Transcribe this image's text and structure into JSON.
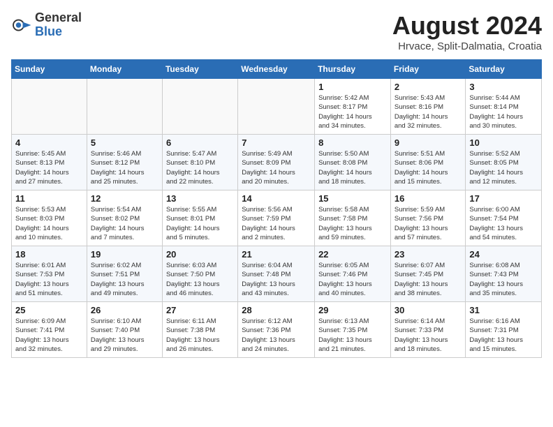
{
  "header": {
    "logo_general": "General",
    "logo_blue": "Blue",
    "month_year": "August 2024",
    "location": "Hrvace, Split-Dalmatia, Croatia"
  },
  "weekdays": [
    "Sunday",
    "Monday",
    "Tuesday",
    "Wednesday",
    "Thursday",
    "Friday",
    "Saturday"
  ],
  "weeks": [
    [
      {
        "day": "",
        "info": ""
      },
      {
        "day": "",
        "info": ""
      },
      {
        "day": "",
        "info": ""
      },
      {
        "day": "",
        "info": ""
      },
      {
        "day": "1",
        "info": "Sunrise: 5:42 AM\nSunset: 8:17 PM\nDaylight: 14 hours\nand 34 minutes."
      },
      {
        "day": "2",
        "info": "Sunrise: 5:43 AM\nSunset: 8:16 PM\nDaylight: 14 hours\nand 32 minutes."
      },
      {
        "day": "3",
        "info": "Sunrise: 5:44 AM\nSunset: 8:14 PM\nDaylight: 14 hours\nand 30 minutes."
      }
    ],
    [
      {
        "day": "4",
        "info": "Sunrise: 5:45 AM\nSunset: 8:13 PM\nDaylight: 14 hours\nand 27 minutes."
      },
      {
        "day": "5",
        "info": "Sunrise: 5:46 AM\nSunset: 8:12 PM\nDaylight: 14 hours\nand 25 minutes."
      },
      {
        "day": "6",
        "info": "Sunrise: 5:47 AM\nSunset: 8:10 PM\nDaylight: 14 hours\nand 22 minutes."
      },
      {
        "day": "7",
        "info": "Sunrise: 5:49 AM\nSunset: 8:09 PM\nDaylight: 14 hours\nand 20 minutes."
      },
      {
        "day": "8",
        "info": "Sunrise: 5:50 AM\nSunset: 8:08 PM\nDaylight: 14 hours\nand 18 minutes."
      },
      {
        "day": "9",
        "info": "Sunrise: 5:51 AM\nSunset: 8:06 PM\nDaylight: 14 hours\nand 15 minutes."
      },
      {
        "day": "10",
        "info": "Sunrise: 5:52 AM\nSunset: 8:05 PM\nDaylight: 14 hours\nand 12 minutes."
      }
    ],
    [
      {
        "day": "11",
        "info": "Sunrise: 5:53 AM\nSunset: 8:03 PM\nDaylight: 14 hours\nand 10 minutes."
      },
      {
        "day": "12",
        "info": "Sunrise: 5:54 AM\nSunset: 8:02 PM\nDaylight: 14 hours\nand 7 minutes."
      },
      {
        "day": "13",
        "info": "Sunrise: 5:55 AM\nSunset: 8:01 PM\nDaylight: 14 hours\nand 5 minutes."
      },
      {
        "day": "14",
        "info": "Sunrise: 5:56 AM\nSunset: 7:59 PM\nDaylight: 14 hours\nand 2 minutes."
      },
      {
        "day": "15",
        "info": "Sunrise: 5:58 AM\nSunset: 7:58 PM\nDaylight: 13 hours\nand 59 minutes."
      },
      {
        "day": "16",
        "info": "Sunrise: 5:59 AM\nSunset: 7:56 PM\nDaylight: 13 hours\nand 57 minutes."
      },
      {
        "day": "17",
        "info": "Sunrise: 6:00 AM\nSunset: 7:54 PM\nDaylight: 13 hours\nand 54 minutes."
      }
    ],
    [
      {
        "day": "18",
        "info": "Sunrise: 6:01 AM\nSunset: 7:53 PM\nDaylight: 13 hours\nand 51 minutes."
      },
      {
        "day": "19",
        "info": "Sunrise: 6:02 AM\nSunset: 7:51 PM\nDaylight: 13 hours\nand 49 minutes."
      },
      {
        "day": "20",
        "info": "Sunrise: 6:03 AM\nSunset: 7:50 PM\nDaylight: 13 hours\nand 46 minutes."
      },
      {
        "day": "21",
        "info": "Sunrise: 6:04 AM\nSunset: 7:48 PM\nDaylight: 13 hours\nand 43 minutes."
      },
      {
        "day": "22",
        "info": "Sunrise: 6:05 AM\nSunset: 7:46 PM\nDaylight: 13 hours\nand 40 minutes."
      },
      {
        "day": "23",
        "info": "Sunrise: 6:07 AM\nSunset: 7:45 PM\nDaylight: 13 hours\nand 38 minutes."
      },
      {
        "day": "24",
        "info": "Sunrise: 6:08 AM\nSunset: 7:43 PM\nDaylight: 13 hours\nand 35 minutes."
      }
    ],
    [
      {
        "day": "25",
        "info": "Sunrise: 6:09 AM\nSunset: 7:41 PM\nDaylight: 13 hours\nand 32 minutes."
      },
      {
        "day": "26",
        "info": "Sunrise: 6:10 AM\nSunset: 7:40 PM\nDaylight: 13 hours\nand 29 minutes."
      },
      {
        "day": "27",
        "info": "Sunrise: 6:11 AM\nSunset: 7:38 PM\nDaylight: 13 hours\nand 26 minutes."
      },
      {
        "day": "28",
        "info": "Sunrise: 6:12 AM\nSunset: 7:36 PM\nDaylight: 13 hours\nand 24 minutes."
      },
      {
        "day": "29",
        "info": "Sunrise: 6:13 AM\nSunset: 7:35 PM\nDaylight: 13 hours\nand 21 minutes."
      },
      {
        "day": "30",
        "info": "Sunrise: 6:14 AM\nSunset: 7:33 PM\nDaylight: 13 hours\nand 18 minutes."
      },
      {
        "day": "31",
        "info": "Sunrise: 6:16 AM\nSunset: 7:31 PM\nDaylight: 13 hours\nand 15 minutes."
      }
    ]
  ]
}
